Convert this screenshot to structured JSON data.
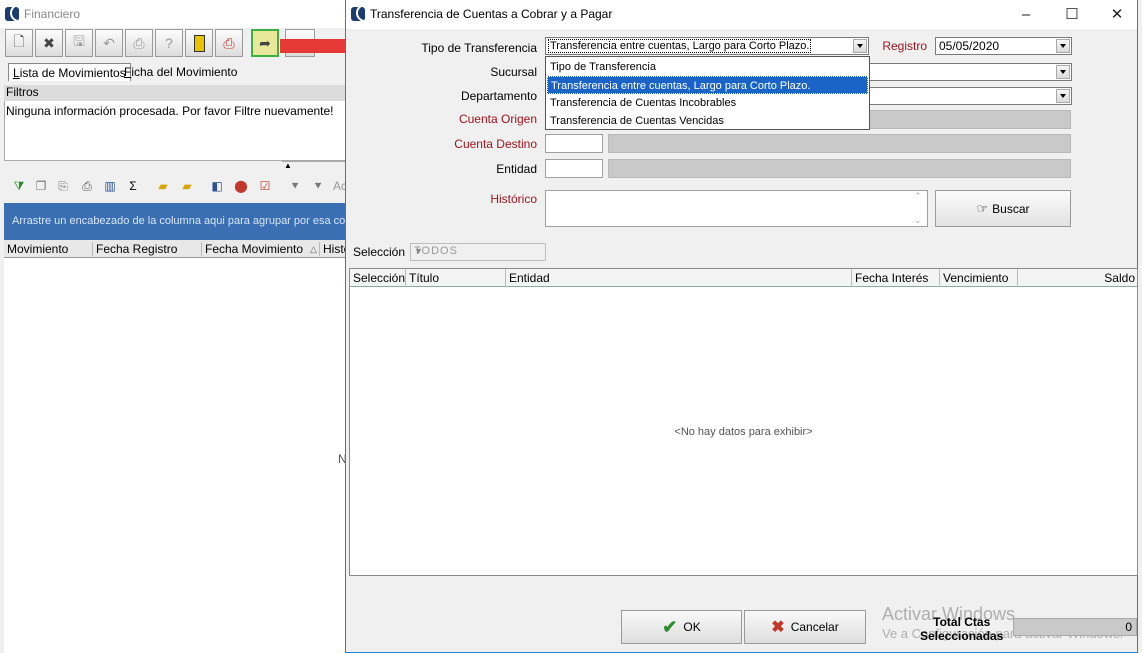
{
  "background_window": {
    "title": "Financiero",
    "tabs": [
      {
        "label_underlined": "L",
        "label_rest": "ista de Movimientos"
      },
      {
        "label_underlined": "F",
        "label_rest": "icha del Movimiento"
      }
    ],
    "filters_header": "Filtros",
    "filters_message": "Ninguna información procesada. Por favor Filtre nuevamente!",
    "group_bar_text": "Arrastre un encabezado de la columna aqui para agrupar por esa columna",
    "columns": [
      "Movimiento",
      "Fecha Registro",
      "Fecha Movimiento",
      "Histó"
    ],
    "cut_text": "N",
    "toolbar_partial": "Ac"
  },
  "dialog": {
    "title": "Transferencia de Cuentas a Cobrar y a Pagar",
    "labels": {
      "tipo": "Tipo de Transferencia",
      "sucursal": "Sucursal",
      "departamento": "Departamento",
      "cuenta_origen": "Cuenta Origen",
      "cuenta_destino": "Cuenta Destino",
      "entidad": "Entidad",
      "historico": "Histórico",
      "registro": "Registro",
      "seleccion": "Selección"
    },
    "tipo_value": "Transferencia entre cuentas, Largo para Corto Plazo.",
    "tipo_options": [
      "Tipo de Transferencia",
      "Transferencia entre cuentas, Largo para Corto Plazo.",
      "Transferencia de Cuentas Incobrables",
      "Transferencia de Cuentas Vencidas"
    ],
    "registro_value": "05/05/2020",
    "buscar_label": "Buscar",
    "seleccion_value": "TODOS",
    "grid_columns": [
      "Selección",
      "Título",
      "Entidad",
      "Fecha Interés",
      "Vencimiento",
      "Saldo"
    ],
    "empty_message": "<No hay datos para exhibir>",
    "ok_label": "OK",
    "cancel_label": "Cancelar",
    "total_label_line1": "Total Ctas",
    "total_label_line2": "Seleccionadas",
    "total_value": "0"
  },
  "watermark": {
    "line1": "Activar Windows",
    "line2": "Ve a Configuración para activar Windows."
  },
  "colors": {
    "accent_blue": "#1a64c8",
    "label_red": "#a0141e",
    "arrow_red": "#e53935",
    "group_bar": "#3a6fb3"
  }
}
